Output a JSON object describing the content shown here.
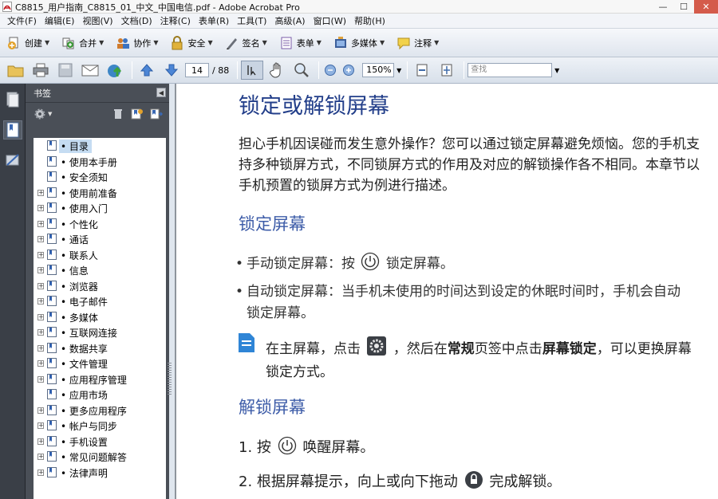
{
  "window": {
    "title": "C8815_用户指南_C8815_01_中文_中国电信.pdf - Adobe Acrobat Pro",
    "minimize": "—",
    "maximize": "☐",
    "close": "✕"
  },
  "menu": [
    "文件(F)",
    "编辑(E)",
    "视图(V)",
    "文档(D)",
    "注释(C)",
    "表单(R)",
    "工具(T)",
    "高级(A)",
    "窗口(W)",
    "帮助(H)"
  ],
  "tasks": [
    {
      "label": "创建",
      "icon": "create-icon"
    },
    {
      "label": "合并",
      "icon": "combine-icon"
    },
    {
      "label": "协作",
      "icon": "collaborate-icon"
    },
    {
      "label": "安全",
      "icon": "lock-icon"
    },
    {
      "label": "签名",
      "icon": "pen-icon"
    },
    {
      "label": "表单",
      "icon": "form-icon"
    },
    {
      "label": "多媒体",
      "icon": "multimedia-icon"
    },
    {
      "label": "注释",
      "icon": "comment-icon"
    }
  ],
  "nav": {
    "page_current": "14",
    "page_total": "/ 88",
    "zoom": "150%",
    "find_placeholder": "查找"
  },
  "bookmarks_panel": {
    "title": "书签",
    "items": [
      {
        "label": "• 目录",
        "expandable": false
      },
      {
        "label": "• 使用本手册",
        "expandable": false
      },
      {
        "label": "• 安全须知",
        "expandable": false
      },
      {
        "label": "• 使用前准备",
        "expandable": true
      },
      {
        "label": "• 使用入门",
        "expandable": true
      },
      {
        "label": "• 个性化",
        "expandable": true
      },
      {
        "label": "• 通话",
        "expandable": true
      },
      {
        "label": "• 联系人",
        "expandable": true
      },
      {
        "label": "• 信息",
        "expandable": true
      },
      {
        "label": "• 浏览器",
        "expandable": true
      },
      {
        "label": "• 电子邮件",
        "expandable": true
      },
      {
        "label": "• 多媒体",
        "expandable": true
      },
      {
        "label": "• 互联网连接",
        "expandable": true
      },
      {
        "label": "• 数据共享",
        "expandable": true
      },
      {
        "label": "• 文件管理",
        "expandable": true
      },
      {
        "label": "• 应用程序管理",
        "expandable": true
      },
      {
        "label": "• 应用市场",
        "expandable": false
      },
      {
        "label": "• 更多应用程序",
        "expandable": true
      },
      {
        "label": "• 帐户与同步",
        "expandable": true
      },
      {
        "label": "• 手机设置",
        "expandable": true
      },
      {
        "label": "• 常见问题解答",
        "expandable": true
      },
      {
        "label": "• 法律声明",
        "expandable": true
      }
    ]
  },
  "document": {
    "heading": "锁定或解锁屏幕",
    "intro": "担心手机因误碰而发生意外操作？您可以通过锁定屏幕避免烦恼。您的手机支持多种锁屏方式，不同锁屏方式的作用及对应的解锁操作各不相同。本章节以手机预置的锁屏方式为例进行描述。",
    "lock_heading": "锁定屏幕",
    "bullet1_pre": "手动锁定屏幕：按",
    "bullet1_post": "锁定屏幕。",
    "bullet2_line1": "自动锁定屏幕：当手机未使用的时间达到设定的休眠时间时，手机会自动",
    "bullet2_line2": "锁定屏幕。",
    "note_pre": "在主屏幕，点击",
    "note_mid": "，然后在",
    "note_bold1": "常规",
    "note_mid2": "页签中点击",
    "note_bold2": "屏幕锁定",
    "note_post": "，可以更换屏幕",
    "note_line2": "锁定方式。",
    "unlock_heading": "解锁屏幕",
    "step1_num": "1.",
    "step1_pre": "按",
    "step1_post": "唤醒屏幕。",
    "step2_num": "2.",
    "step2_pre": "根据屏幕提示，向上或向下拖动",
    "step2_post": "完成解锁。"
  }
}
